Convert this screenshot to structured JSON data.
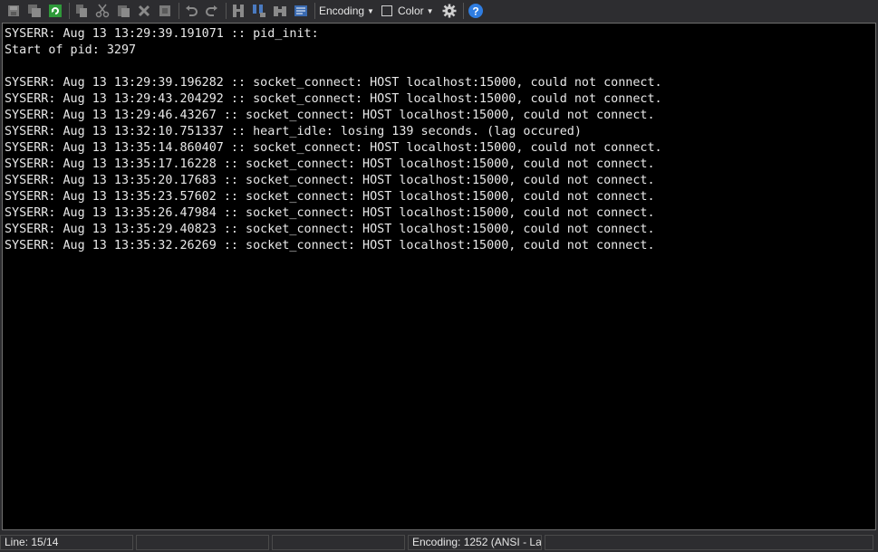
{
  "toolbar": {
    "encoding_label": "Encoding",
    "color_label": "Color",
    "icons": [
      "save-icon",
      "save-all-icon",
      "refresh-icon",
      "copy-icon",
      "cut-icon",
      "paste-icon",
      "delete-icon",
      "stop-icon",
      "undo-icon",
      "redo-icon",
      "find-icon",
      "find-next-icon",
      "binoculars-icon",
      "wrap-icon",
      "settings-icon",
      "help-icon"
    ]
  },
  "console": {
    "lines": [
      "SYSERR: Aug 13 13:29:39.191071 :: pid_init:",
      "Start of pid: 3297",
      "",
      "SYSERR: Aug 13 13:29:39.196282 :: socket_connect: HOST localhost:15000, could not connect.",
      "SYSERR: Aug 13 13:29:43.204292 :: socket_connect: HOST localhost:15000, could not connect.",
      "SYSERR: Aug 13 13:29:46.43267 :: socket_connect: HOST localhost:15000, could not connect.",
      "SYSERR: Aug 13 13:32:10.751337 :: heart_idle: losing 139 seconds. (lag occured)",
      "SYSERR: Aug 13 13:35:14.860407 :: socket_connect: HOST localhost:15000, could not connect.",
      "SYSERR: Aug 13 13:35:17.16228 :: socket_connect: HOST localhost:15000, could not connect.",
      "SYSERR: Aug 13 13:35:20.17683 :: socket_connect: HOST localhost:15000, could not connect.",
      "SYSERR: Aug 13 13:35:23.57602 :: socket_connect: HOST localhost:15000, could not connect.",
      "SYSERR: Aug 13 13:35:26.47984 :: socket_connect: HOST localhost:15000, could not connect.",
      "SYSERR: Aug 13 13:35:29.40823 :: socket_connect: HOST localhost:15000, could not connect.",
      "SYSERR: Aug 13 13:35:32.26269 :: socket_connect: HOST localhost:15000, could not connect."
    ]
  },
  "statusbar": {
    "line": "Line: 15/14",
    "panel2": "",
    "panel3": "",
    "encoding": "Encoding: 1252  (ANSI - La",
    "panel5": ""
  },
  "colors": {
    "background": "#000000",
    "text": "#e8e8e8",
    "chrome": "#2d2d30",
    "help_accent": "#2f7de1"
  }
}
